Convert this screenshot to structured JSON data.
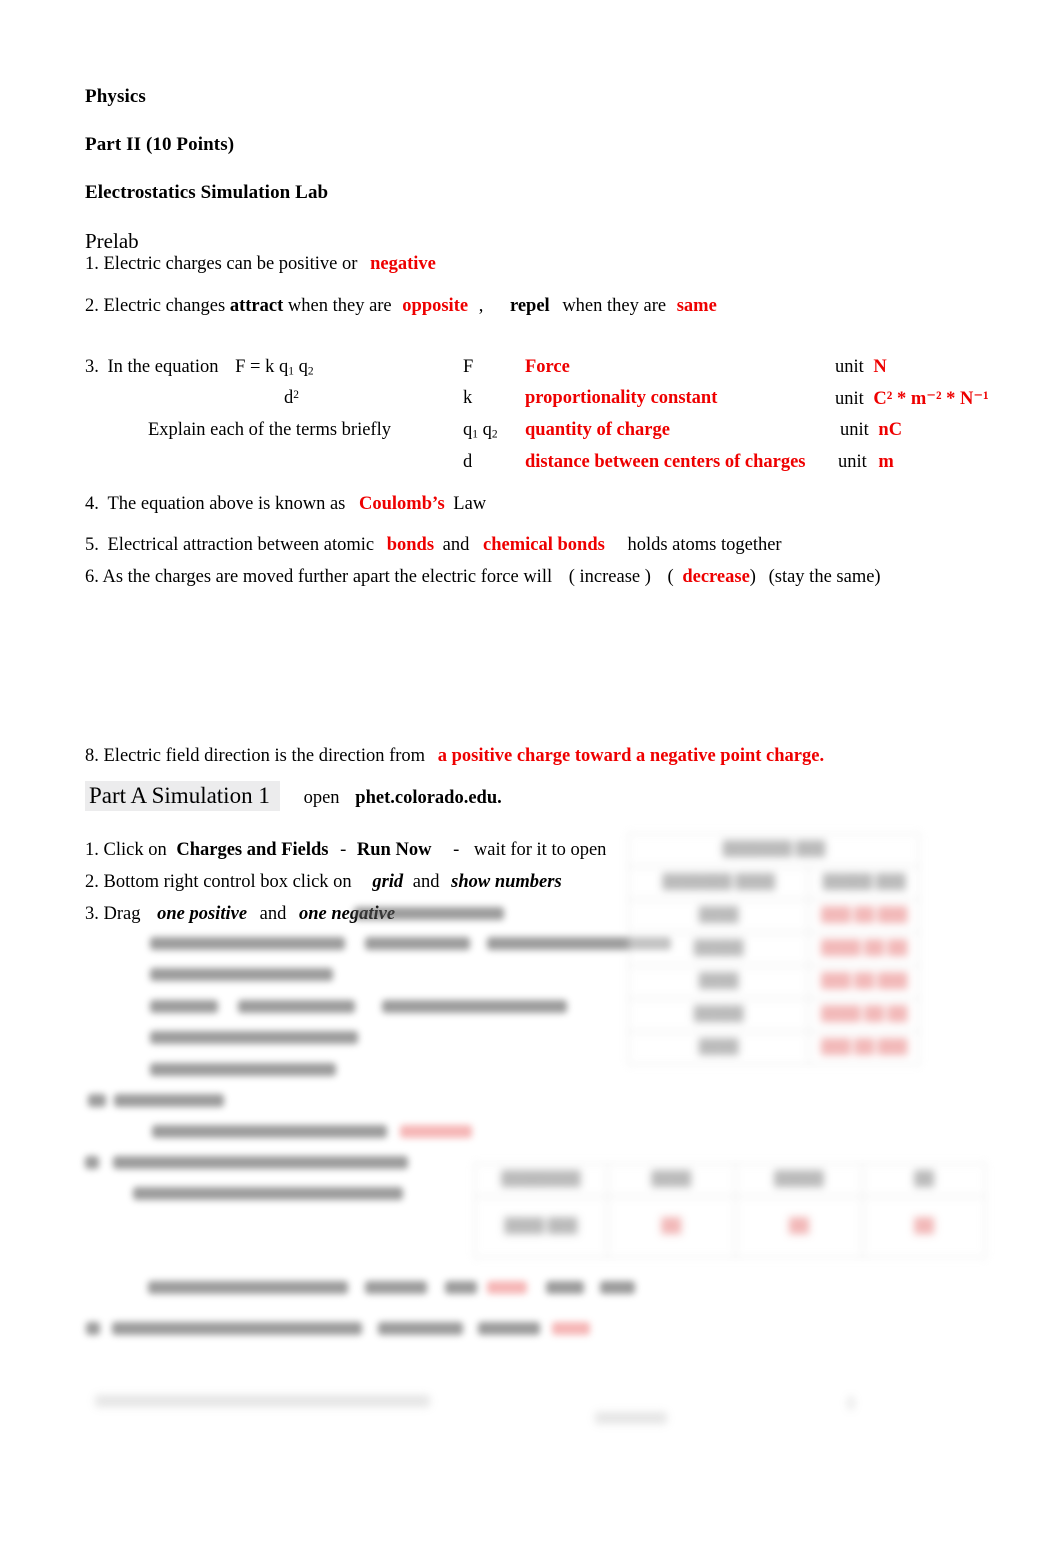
{
  "document": {
    "title": "Physics",
    "part_heading": "Part II (10 Points)",
    "lab_heading": "Electrostatics Simulation Lab"
  },
  "prelab": {
    "label": "Prelab",
    "q1": {
      "number": "1.",
      "text": "Electric charges can be positive or",
      "answer": "negative"
    },
    "q2": {
      "number": "2.",
      "lead": "Electric changes",
      "bold1": "attract",
      "mid1": "when they are",
      "answer1": "opposite",
      "comma": ",",
      "bold2": "repel",
      "mid2": "when they are",
      "answer2": "same"
    },
    "q3": {
      "number": "3.",
      "lead": "In the equation",
      "equation_numerator": "F  =   k q",
      "equation_sub1": "1",
      "equation_q2": " q",
      "equation_sub2": "2",
      "equation_denominator": "d",
      "equation_denominator_sup": "2",
      "instruction": "Explain each of the terms briefly",
      "unit_label": "unit",
      "terms": [
        {
          "symbol": "F",
          "meaning": "Force",
          "unit": "N"
        },
        {
          "symbol": "k",
          "meaning": "proportionality constant",
          "unit": "C² * m⁻² * N⁻¹"
        },
        {
          "symbol": "q1 q2",
          "meaning": "quantity of charge",
          "unit": "nC"
        },
        {
          "symbol": "d",
          "meaning": "distance between centers of charges",
          "unit": "m"
        }
      ]
    },
    "q4": {
      "number": "4.",
      "lead": "The equation above is known as",
      "answer": "Coulomb’s",
      "tail": "Law"
    },
    "q5": {
      "number": "5.",
      "lead": "Electrical attraction between   atomic",
      "answer1": "bonds",
      "mid": "and",
      "answer2": "chemical bonds",
      "tail": "holds atoms together"
    },
    "q6": {
      "number": "6.",
      "lead": "As the charges are moved further apart the electric force will",
      "option1": "( increase )",
      "option2_open": "(",
      "answer": "decrease",
      "option2_close": ")",
      "option3": "(stay the same)"
    },
    "q8": {
      "number": "8.",
      "lead": "Electric field direction is the direction from",
      "answer": "a positive charge toward a negative point charge."
    }
  },
  "part_a": {
    "heading": "Part A  Simulation 1",
    "open_label": "open",
    "url": "phet.colorado.edu.",
    "steps": [
      {
        "number": "1.",
        "pre": "Click on",
        "bold1": "Charges and Fields",
        "dash1": "-",
        "bold2": "Run Now",
        "dash2": "-",
        "tail": "wait for it to open"
      },
      {
        "number": "2.",
        "pre": "Bottom right control box  click on",
        "ital1": "grid",
        "mid": "and",
        "ital2": "show numbers",
        "tail": ""
      },
      {
        "number": "3.",
        "pre": "Drag",
        "ital1": "one positive",
        "mid": "and",
        "ital2": "one negative",
        "tail": ""
      }
    ]
  },
  "redacted": {
    "note": "blurred-illegible-content",
    "table_1": {
      "caption_placeholder": "███████ ███",
      "headers": [
        "███████ ████",
        "█████ ███"
      ],
      "rows": [
        [
          "████",
          "███ ██ ███"
        ],
        [
          "█████",
          "████ ██ ██"
        ],
        [
          "████",
          "███ ██ ███"
        ],
        [
          "█████",
          "████ ██ ██"
        ],
        [
          "████",
          "███ ██ ███"
        ]
      ]
    },
    "table_2": {
      "headers": [
        "████████",
        "████",
        "█████",
        "██"
      ],
      "rows": [
        [
          "████ ███",
          "██",
          "██",
          "██"
        ]
      ]
    }
  }
}
